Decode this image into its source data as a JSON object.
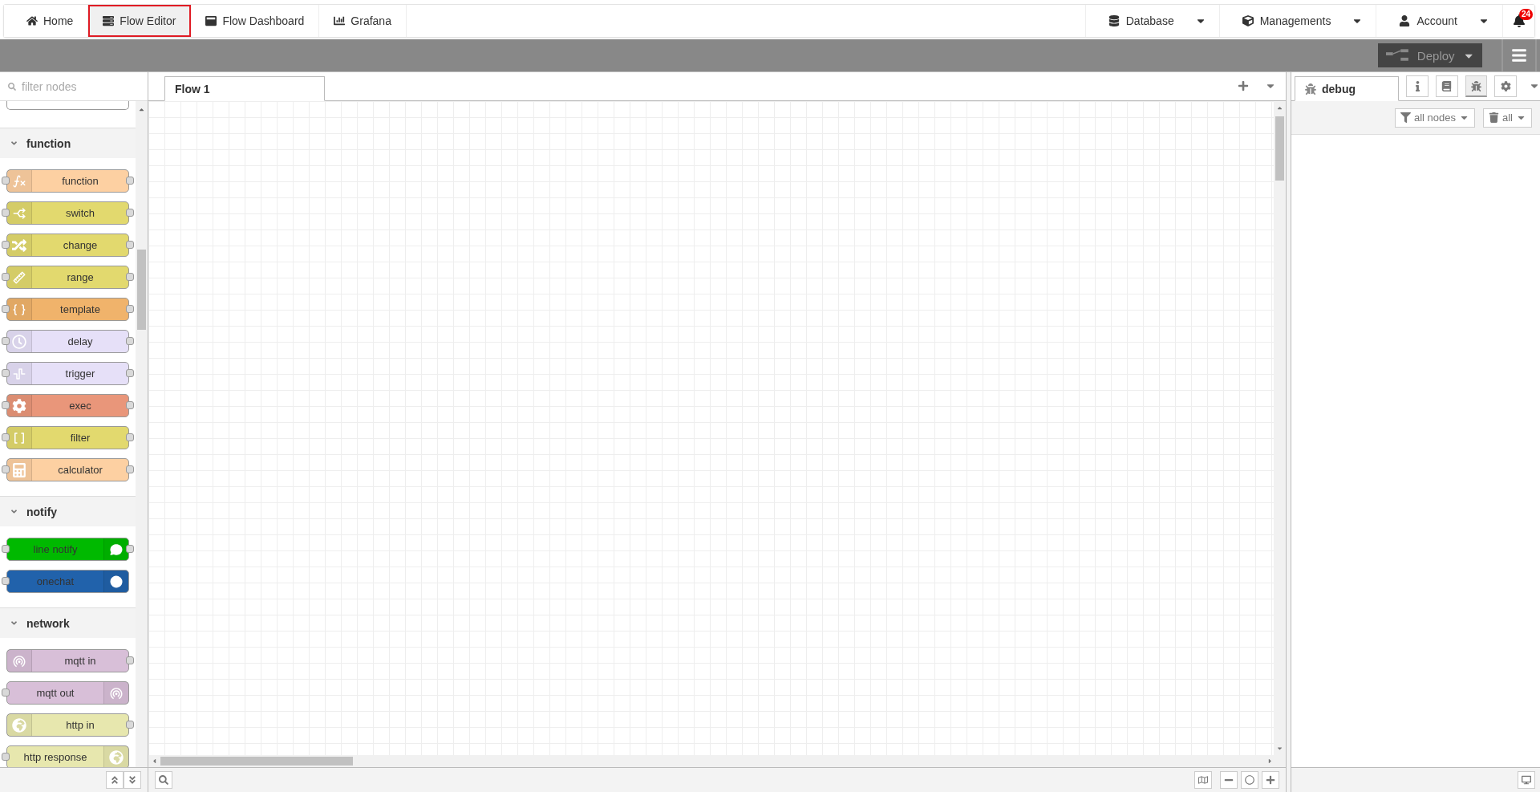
{
  "nav": {
    "left": [
      {
        "label": "Home",
        "selected": false
      },
      {
        "label": "Flow Editor",
        "selected": true
      },
      {
        "label": "Flow Dashboard",
        "selected": false
      },
      {
        "label": "Grafana",
        "selected": false
      }
    ],
    "right": [
      {
        "label": "Database"
      },
      {
        "label": "Managements"
      },
      {
        "label": "Account"
      }
    ],
    "notifications": {
      "count": "24"
    }
  },
  "header": {
    "deploy": {
      "label": "Deploy",
      "disabled": true
    }
  },
  "palette": {
    "search": {
      "placeholder": "filter nodes"
    },
    "categories": [
      {
        "title": "function",
        "expanded": true,
        "nodes": [
          {
            "label": "function",
            "color": "#fdd0a2",
            "kind": "function",
            "input": true,
            "output": true,
            "icon_right": false
          },
          {
            "label": "switch",
            "color": "#e2d96e",
            "kind": "switch",
            "input": true,
            "output": true,
            "icon_right": false
          },
          {
            "label": "change",
            "color": "#e2d96e",
            "kind": "change",
            "input": true,
            "output": true,
            "icon_right": false
          },
          {
            "label": "range",
            "color": "#e2d96e",
            "kind": "range",
            "input": true,
            "output": true,
            "icon_right": false
          },
          {
            "label": "template",
            "color": "#f0b36b",
            "kind": "template",
            "input": true,
            "output": true,
            "icon_right": false
          },
          {
            "label": "delay",
            "color": "#e6e0f8",
            "kind": "delay",
            "input": true,
            "output": true,
            "icon_right": false
          },
          {
            "label": "trigger",
            "color": "#e6e0f8",
            "kind": "trigger",
            "input": true,
            "output": true,
            "icon_right": false
          },
          {
            "label": "exec",
            "color": "#e9967a",
            "kind": "exec",
            "input": true,
            "output": true,
            "icon_right": false
          },
          {
            "label": "filter",
            "color": "#e2d96e",
            "kind": "filter",
            "input": true,
            "output": true,
            "icon_right": false
          },
          {
            "label": "calculator",
            "color": "#fdd0a2",
            "kind": "calculator",
            "input": true,
            "output": true,
            "icon_right": false
          }
        ]
      },
      {
        "title": "notify",
        "expanded": true,
        "nodes": [
          {
            "label": "line notify",
            "color": "#00b900",
            "kind": "chat",
            "input": true,
            "output": true,
            "icon_right": true
          },
          {
            "label": "onechat",
            "color": "#2162ab",
            "kind": "one",
            "input": true,
            "output": false,
            "icon_right": true
          }
        ]
      },
      {
        "title": "network",
        "expanded": true,
        "nodes": [
          {
            "label": "mqtt in",
            "color": "#d8bfd8",
            "kind": "mqtt",
            "input": false,
            "output": true,
            "icon_right": false
          },
          {
            "label": "mqtt out",
            "color": "#d8bfd8",
            "kind": "mqtt",
            "input": true,
            "output": false,
            "icon_right": true
          },
          {
            "label": "http in",
            "color": "#e7e7ae",
            "kind": "http",
            "input": false,
            "output": true,
            "icon_right": false
          },
          {
            "label": "http response",
            "color": "#e7e7ae",
            "kind": "http",
            "input": true,
            "output": false,
            "icon_right": true
          }
        ]
      }
    ]
  },
  "workspace": {
    "tabs": [
      {
        "label": "Flow 1",
        "selected": true
      }
    ]
  },
  "sidebar": {
    "tabs": [
      {
        "label": "debug",
        "selected": true
      }
    ],
    "buttons": [
      {
        "kind": "info",
        "selected": false
      },
      {
        "kind": "book",
        "selected": false
      },
      {
        "kind": "bug",
        "selected": true
      },
      {
        "kind": "gear",
        "selected": false
      }
    ],
    "filter": {
      "label": "all nodes"
    },
    "clear": {
      "label": "all"
    }
  }
}
